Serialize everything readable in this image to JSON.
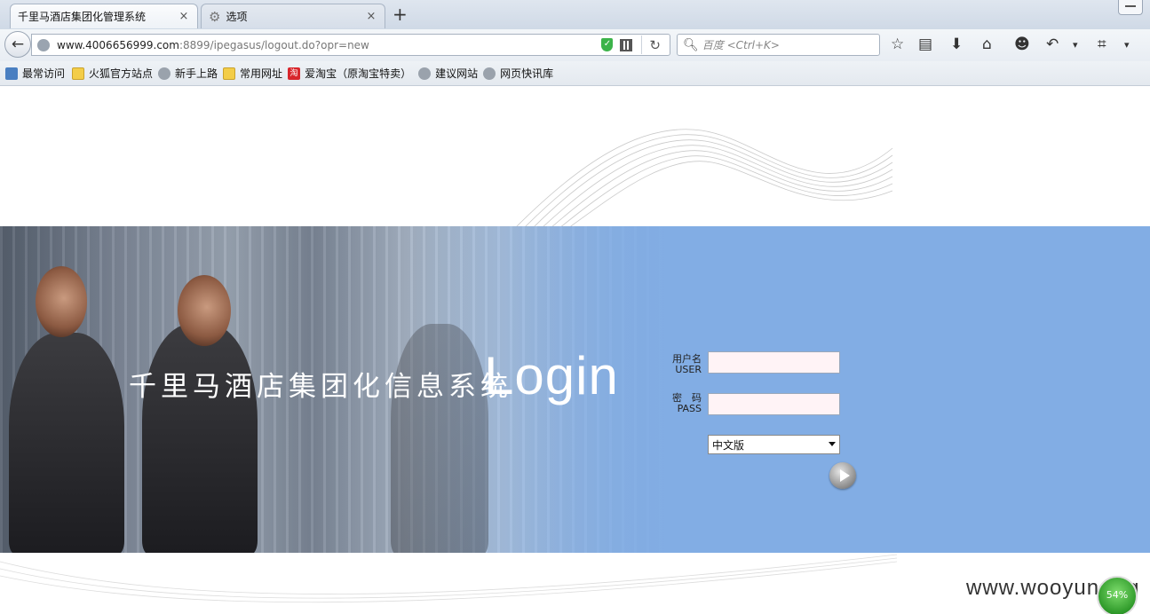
{
  "browser": {
    "tabs": [
      {
        "label": "千里马酒店集团化管理系统",
        "close": "×"
      },
      {
        "label": "选项",
        "close": "×"
      }
    ],
    "new_tab": "+",
    "url_host": "www.4006656999.com",
    "url_rest": ":8899/ipegasus/logout.do?opr=new",
    "search_placeholder": "百度 <Ctrl+K>",
    "bookmarks": [
      {
        "label": "最常访问",
        "icon": "most-visited-icon"
      },
      {
        "label": "火狐官方站点",
        "icon": "folder-icon"
      },
      {
        "label": "新手上路",
        "icon": "globe-icon"
      },
      {
        "label": "常用网址",
        "icon": "folder-icon"
      },
      {
        "label": "爱淘宝（原淘宝特卖）",
        "icon": "taobao-icon"
      },
      {
        "label": "建议网站",
        "icon": "globe-icon"
      },
      {
        "label": "网页快讯库",
        "icon": "globe-icon"
      }
    ]
  },
  "login": {
    "brand": "千里马酒店集团化信息系统",
    "title": "Login",
    "user_label_cn": "用户名",
    "user_label_en": "USER",
    "pass_label_cn": "密　码",
    "pass_label_en": "PASS",
    "language_selected": "中文版"
  },
  "watermark": "www.wooyun.org",
  "meter_value": "54%",
  "colors": {
    "banner": "#82ade4",
    "input_bg": "#fff3f6"
  }
}
